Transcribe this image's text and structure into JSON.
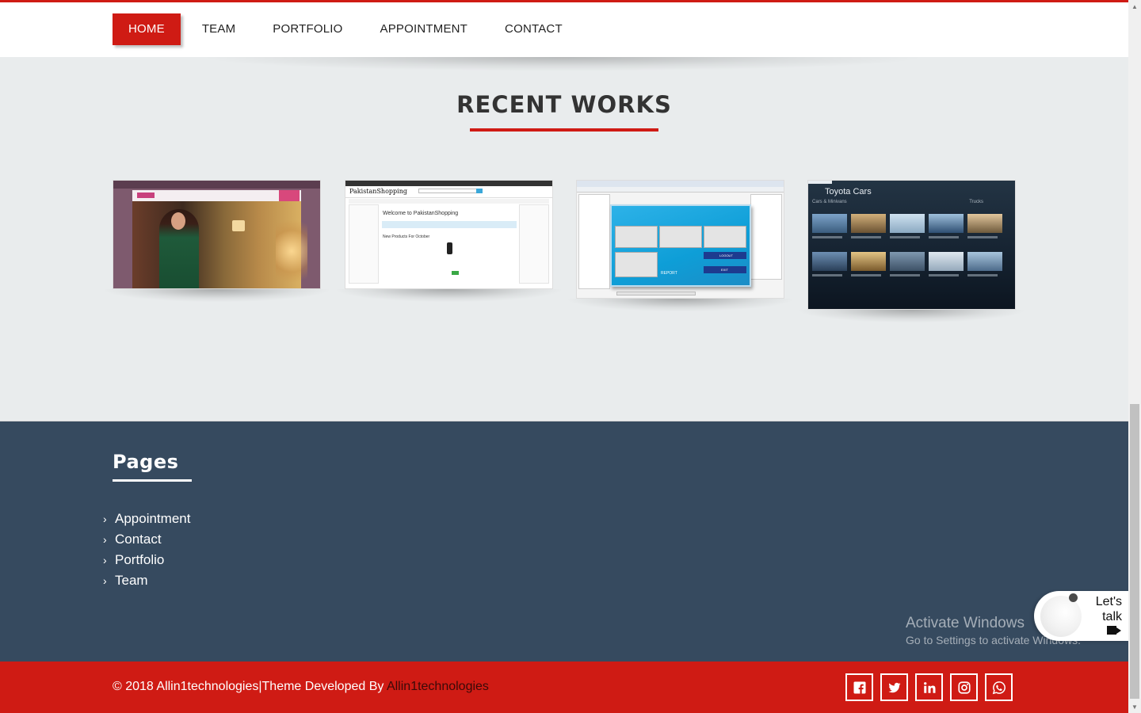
{
  "nav": {
    "items": [
      {
        "label": "HOME",
        "active": true
      },
      {
        "label": "TEAM",
        "active": false
      },
      {
        "label": "PORTFOLIO",
        "active": false
      },
      {
        "label": "APPOINTMENT",
        "active": false
      },
      {
        "label": "CONTACT",
        "active": false
      }
    ]
  },
  "recent_works": {
    "title": "RECENT WORKS",
    "items": [
      {
        "name": "fashion-store-screenshot"
      },
      {
        "name": "pakistan-shopping-screenshot",
        "brand": "PakistanShopping",
        "welcome": "Welcome to PakistanShopping",
        "new_products": "New Products For October"
      },
      {
        "name": "desktop-app-screenshot",
        "buttons": [
          "LOGOUT",
          "EXIT"
        ],
        "report": "REPORT"
      },
      {
        "name": "toyota-cars-screenshot",
        "title": "Toyota Cars",
        "subtitle": "Cars & Minivans",
        "subtitle2": "Trucks"
      }
    ]
  },
  "footer": {
    "pages_title": "Pages",
    "links": [
      "Appointment",
      "Contact",
      "Portfolio",
      "Team"
    ]
  },
  "watermark": {
    "line1": "Activate Windows",
    "line2": "Go to Settings to activate Windows."
  },
  "chat_widget": {
    "line1": "Let's",
    "line2": "talk"
  },
  "bottom_bar": {
    "copyright": "© 2018 Allin1technologies|Theme Developed By ",
    "brand_link": "Allin1technologies",
    "socials": [
      "facebook-icon",
      "twitter-icon",
      "linkedin-icon",
      "instagram-icon",
      "whatsapp-icon"
    ]
  },
  "colors": {
    "accent": "#cf1b14",
    "footer_bg": "#364a5f",
    "page_bg": "#e9eced"
  }
}
